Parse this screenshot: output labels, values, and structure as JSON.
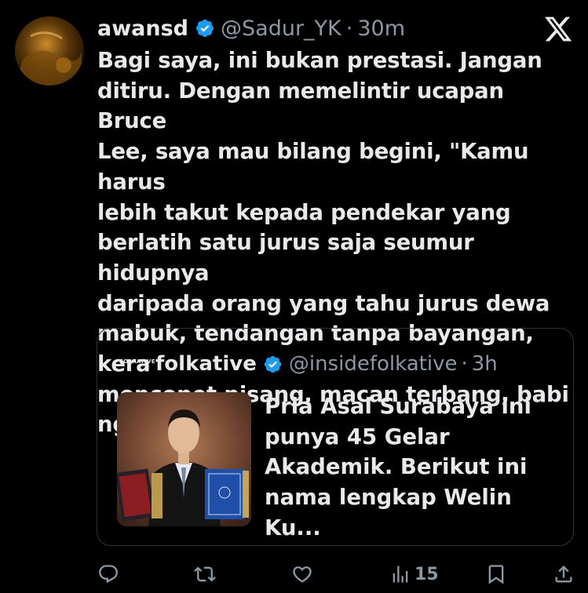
{
  "tweet": {
    "author_name": "awansd",
    "handle": "@Sadur_YK",
    "separator": "·",
    "time": "30m",
    "text": "Bagi saya, ini bukan prestasi. Jangan\nditiru. Dengan memelintir ucapan Bruce\nLee, saya mau bilang begini, \"Kamu harus\nlebih takut kepada pendekar yang\nberlatih satu jurus saja seumur hidupnya\ndaripada orang yang tahu jurus dewa\nmabuk, tendangan tanpa bayangan, kera\nmencopet pisang, macan terbang, babi\nngepet, dll.\""
  },
  "quote": {
    "logo_text": "FOLKATIVE",
    "author_name": "folkative",
    "handle": "@insidefolkative",
    "separator": "·",
    "time": "3h",
    "text": "Pria Asal Surabaya ini\npunya 45 Gelar\nAkademik. Berikut ini\nnama lengkap Welin Ku..."
  },
  "actions": {
    "views_count": "15"
  },
  "icons": {
    "close": "x-logo-icon",
    "verified": "verified-badge-icon",
    "reply": "reply-icon",
    "retweet": "retweet-icon",
    "like": "like-icon",
    "views": "views-icon",
    "bookmark": "bookmark-icon",
    "share": "share-icon"
  },
  "colors": {
    "background": "#000000",
    "text_primary": "#e7e9ea",
    "text_muted": "#8b98a5",
    "verified_blue": "#1d9bf0",
    "border": "#2f3336"
  }
}
